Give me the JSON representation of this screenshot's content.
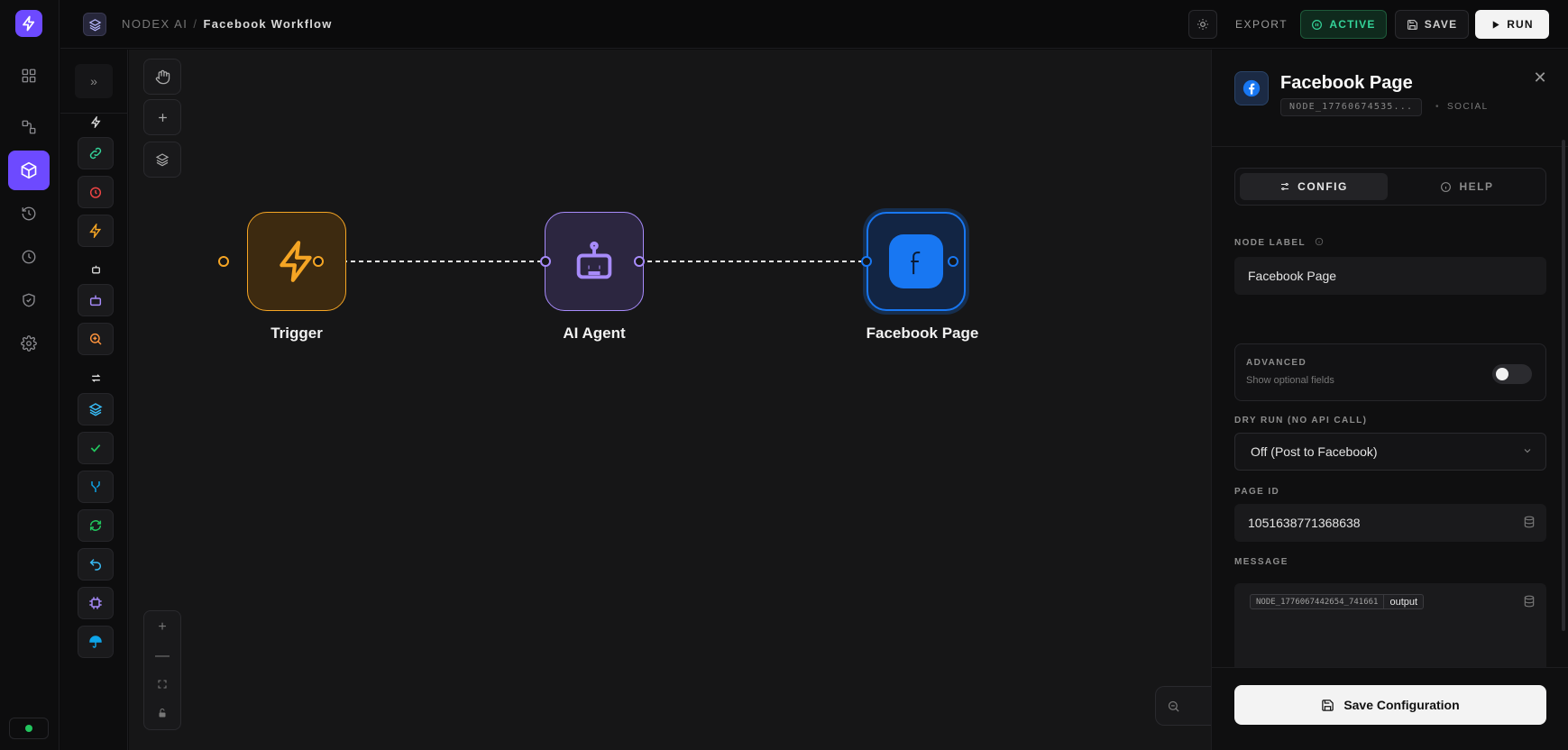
{
  "app": {
    "name": "NODEX AI",
    "workflow_name": "Facebook Workflow"
  },
  "toolbar": {
    "export_label": "EXPORT",
    "active_label": "ACTIVE",
    "save_label": "SAVE",
    "run_label": "RUN"
  },
  "sidebar": {
    "items": [
      {
        "icon": "dashboard-icon"
      },
      {
        "icon": "workflow-icon"
      },
      {
        "icon": "cube-icon",
        "active": true
      },
      {
        "icon": "history-icon"
      },
      {
        "icon": "clock-icon"
      },
      {
        "icon": "shield-icon"
      },
      {
        "icon": "settings-icon"
      }
    ],
    "status_color": "#22c55e"
  },
  "canvas": {
    "nodes": [
      {
        "id": "trigger",
        "label": "Trigger",
        "icon": "lightning-icon",
        "color": "#f5a524"
      },
      {
        "id": "ai-agent",
        "label": "AI Agent",
        "icon": "robot-icon",
        "color": "#a78bfa"
      },
      {
        "id": "facebook-page",
        "label": "Facebook Page",
        "icon": "facebook-icon",
        "color": "#1877f2",
        "selected": true
      }
    ]
  },
  "panel": {
    "title": "Facebook Page",
    "node_id": "NODE_17760674535...",
    "category": "SOCIAL",
    "tabs": [
      {
        "label": "CONFIG",
        "active": true
      },
      {
        "label": "HELP"
      }
    ],
    "node_label_label": "NODE LABEL",
    "node_label_value": "Facebook Page",
    "advanced_title": "ADVANCED",
    "advanced_sub": "Show optional fields",
    "advanced_on": false,
    "dry_run_label": "DRY RUN (NO API CALL)",
    "dry_run_value": "Off (Post to Facebook)",
    "page_id_label": "PAGE ID",
    "page_id_value": "1051638771368638",
    "message_label": "MESSAGE",
    "message_chip_node": "NODE_1776067442654_741661",
    "message_chip_field": "output",
    "save_button": "Save Configuration"
  }
}
